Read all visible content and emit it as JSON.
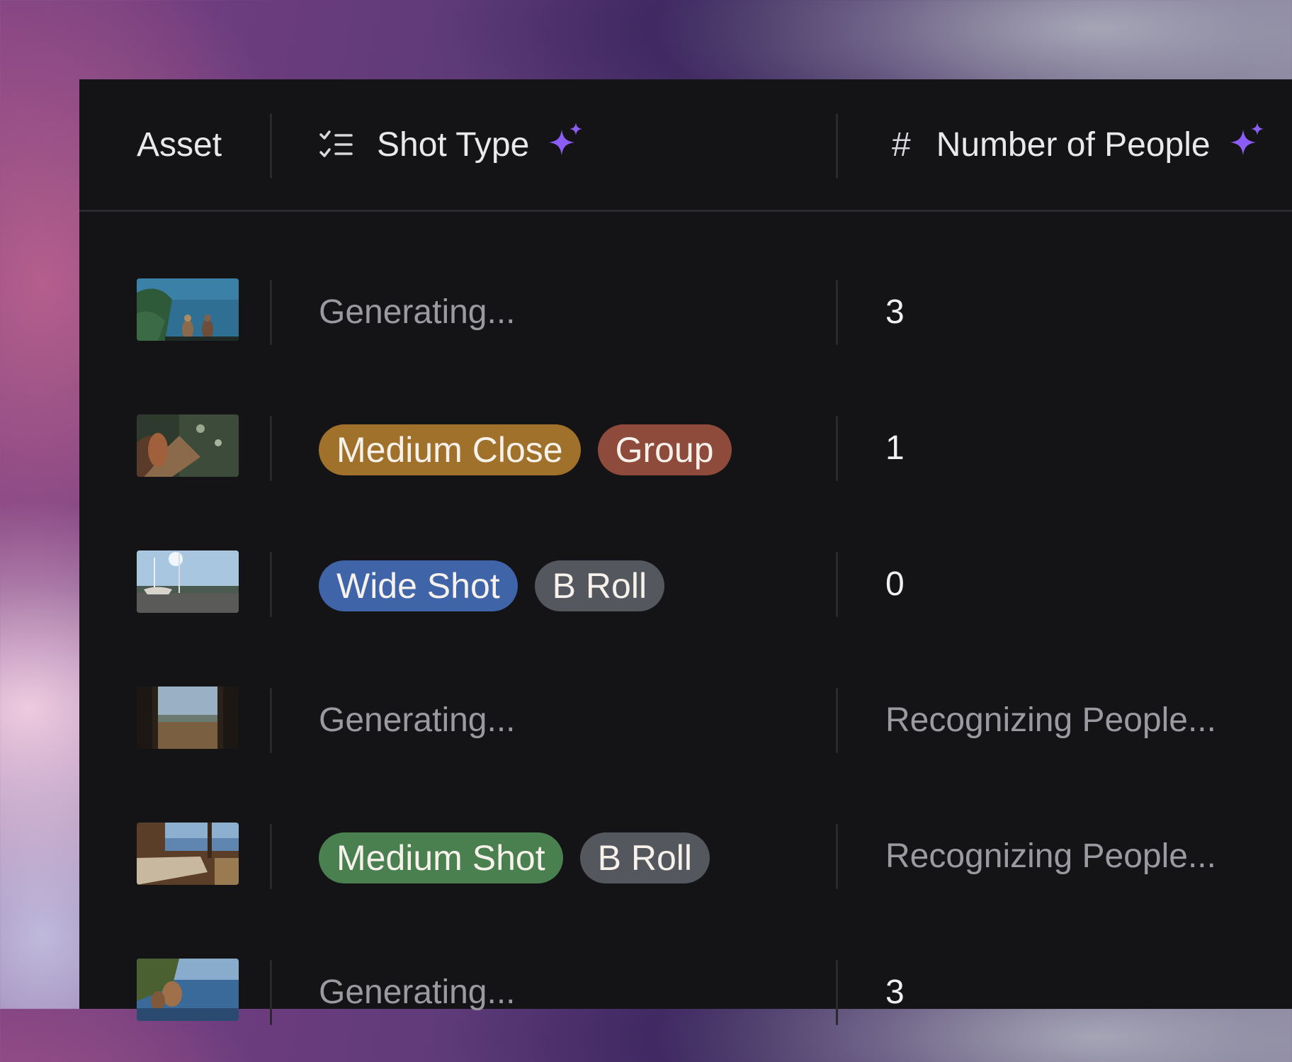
{
  "columns": {
    "asset": "Asset",
    "shot_type": "Shot Type",
    "people_hash": "#",
    "people": "Number of People"
  },
  "colors": {
    "panel": "#141417",
    "sparkle": "#8b5cf6",
    "tag_medium_close": "#a0712a",
    "tag_group": "#8e4a3a",
    "tag_wide_shot": "#3f64a8",
    "tag_broll": "#55575f",
    "tag_medium_shot": "#4a8050"
  },
  "rows": [
    {
      "thumb": "lake-swimmers",
      "shot_status": "Generating...",
      "people": "3"
    },
    {
      "thumb": "dock-sunbather",
      "tags": [
        "Medium Close",
        "Group"
      ],
      "people": "1"
    },
    {
      "thumb": "boats-shoreline",
      "tags": [
        "Wide Shot",
        "B Roll"
      ],
      "people": "0"
    },
    {
      "thumb": "window-landscape",
      "shot_status": "Generating...",
      "people_status": "Recognizing People..."
    },
    {
      "thumb": "cabin-interior",
      "tags": [
        "Medium Shot",
        "B Roll"
      ],
      "people_status": "Recognizing People..."
    },
    {
      "thumb": "lake-group",
      "shot_status": "Generating...",
      "people": "3"
    }
  ]
}
